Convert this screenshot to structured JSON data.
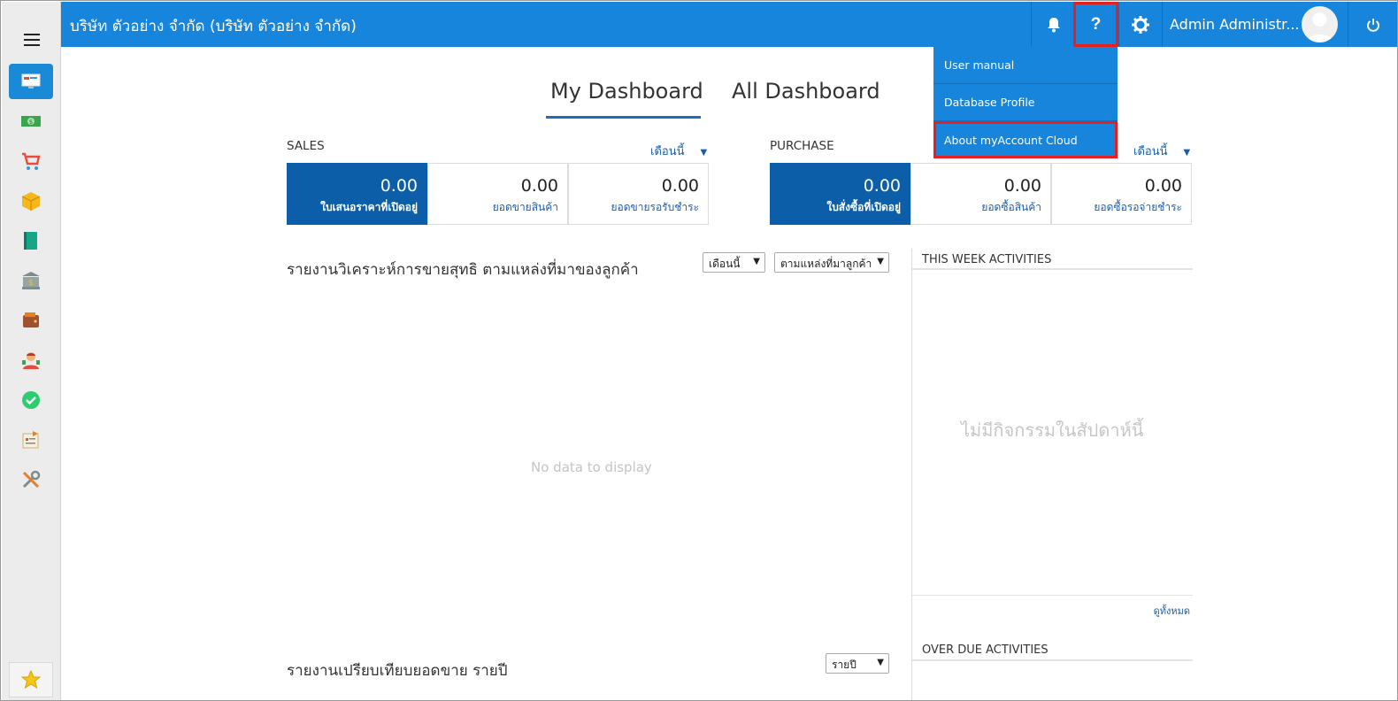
{
  "header": {
    "company": "บริษัท ตัวอย่าง จำกัด (บริษัท ตัวอย่าง จำกัด)",
    "user_name": "Admin Administr...",
    "help_label": "?"
  },
  "help_menu": {
    "items": [
      {
        "label": "User manual"
      },
      {
        "label": "Database Profile"
      },
      {
        "label": "About myAccount Cloud"
      }
    ]
  },
  "tabs": [
    {
      "label": "My Dashboard",
      "active": true
    },
    {
      "label": "All Dashboard",
      "active": false
    }
  ],
  "sales": {
    "title": "SALES",
    "period": "เดือนนี้",
    "cards": [
      {
        "value": "0.00",
        "label": "ใบเสนอราคาที่เปิดอยู่"
      },
      {
        "value": "0.00",
        "label": "ยอดขายสินค้า"
      },
      {
        "value": "0.00",
        "label": "ยอดขายรอรับชำระ"
      }
    ]
  },
  "purchase": {
    "title": "PURCHASE",
    "period": "เดือนนี้",
    "cards": [
      {
        "value": "0.00",
        "label": "ใบสั่งซื้อที่เปิดอยู่"
      },
      {
        "value": "0.00",
        "label": "ยอดซื้อสินค้า"
      },
      {
        "value": "0.00",
        "label": "ยอดซื้อรอจ่ายชำระ"
      }
    ]
  },
  "report1": {
    "title": "รายงานวิเคราะห์การขายสุทธิ ตามแหล่งที่มาของลูกค้า",
    "period_select": "เดือนนี้",
    "source_select": "ตามแหล่งที่มาลูกค้า",
    "empty": "No data to display"
  },
  "report2": {
    "title": "รายงานเปรียบเทียบยอดขาย รายปี",
    "period_select": "รายปี"
  },
  "activities": {
    "this_week_title": "THIS WEEK ACTIVITIES",
    "this_week_empty": "ไม่มีกิจกรรมในสัปดาห์นี้",
    "see_all": "ดูทั้งหมด",
    "overdue_title": "OVER DUE ACTIVITIES"
  },
  "colors": {
    "topbar": "#1785dc",
    "kpi_active": "#0d5ea8",
    "highlight": "#e52020"
  },
  "sidebar": {
    "items": [
      "dashboard-icon",
      "money-icon",
      "cart-icon",
      "box-icon",
      "book-icon",
      "bank-icon",
      "wallet-icon",
      "person-icon",
      "check-icon",
      "report-icon",
      "tools-icon"
    ],
    "favorite": "star-icon"
  }
}
